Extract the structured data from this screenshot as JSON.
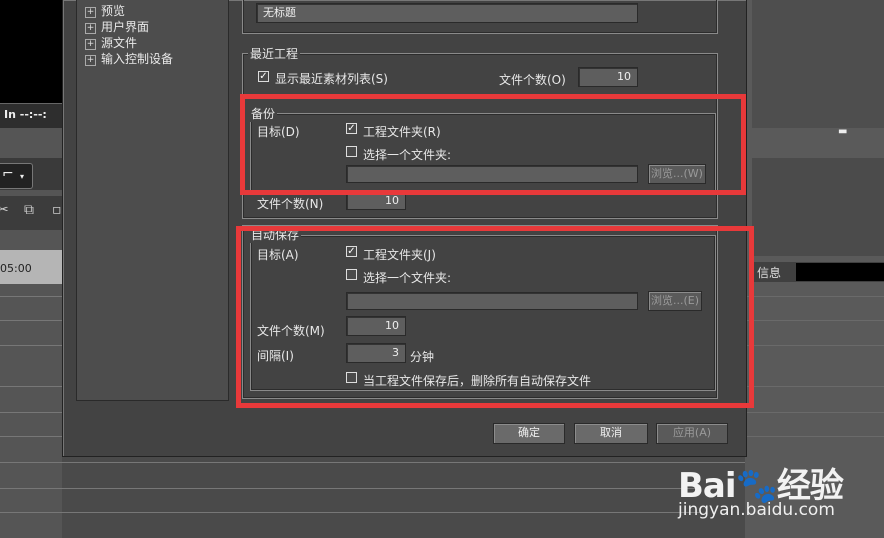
{
  "background_app": {
    "timecode_in": "In --:--:",
    "ruler_time": "05:00",
    "info_label": "信息"
  },
  "tree": {
    "items": [
      "预览",
      "用户界面",
      "源文件",
      "输入控制设备"
    ]
  },
  "project_name": {
    "value": "无标题"
  },
  "recent_projects": {
    "legend": "最近工程",
    "show_list_label": "显示最近素材列表(S)",
    "show_list_checked": true,
    "file_count_label": "文件个数(O)",
    "file_count_value": "10"
  },
  "backup": {
    "legend": "备份",
    "target_label": "目标(D)",
    "project_folder_label": "工程文件夹(R)",
    "project_folder_checked": true,
    "select_folder_label": "选择一个文件夹:",
    "select_folder_checked": false,
    "folder_path_value": "",
    "browse_label": "浏览...(W)",
    "file_count_label": "文件个数(N)",
    "file_count_value": "10"
  },
  "autosave": {
    "legend": "自动保存",
    "target_label": "目标(A)",
    "project_folder_label": "工程文件夹(J)",
    "project_folder_checked": true,
    "select_folder_label": "选择一个文件夹:",
    "select_folder_checked": false,
    "folder_path_value": "",
    "browse_label": "浏览...(E)",
    "file_count_label": "文件个数(M)",
    "file_count_value": "10",
    "interval_label": "间隔(I)",
    "interval_value": "3",
    "interval_unit": "分钟",
    "delete_after_save_label": "当工程文件保存后，删除所有自动保存文件",
    "delete_after_save_checked": false
  },
  "footer": {
    "ok_label": "确定",
    "cancel_label": "取消",
    "apply_label": "应用(A)"
  },
  "watermark": {
    "logo": "Bai🐾经验",
    "url": "jingyan.baidu.com"
  },
  "colors": {
    "highlight_red": "#e8393a",
    "dialog_bg": "#434343"
  }
}
